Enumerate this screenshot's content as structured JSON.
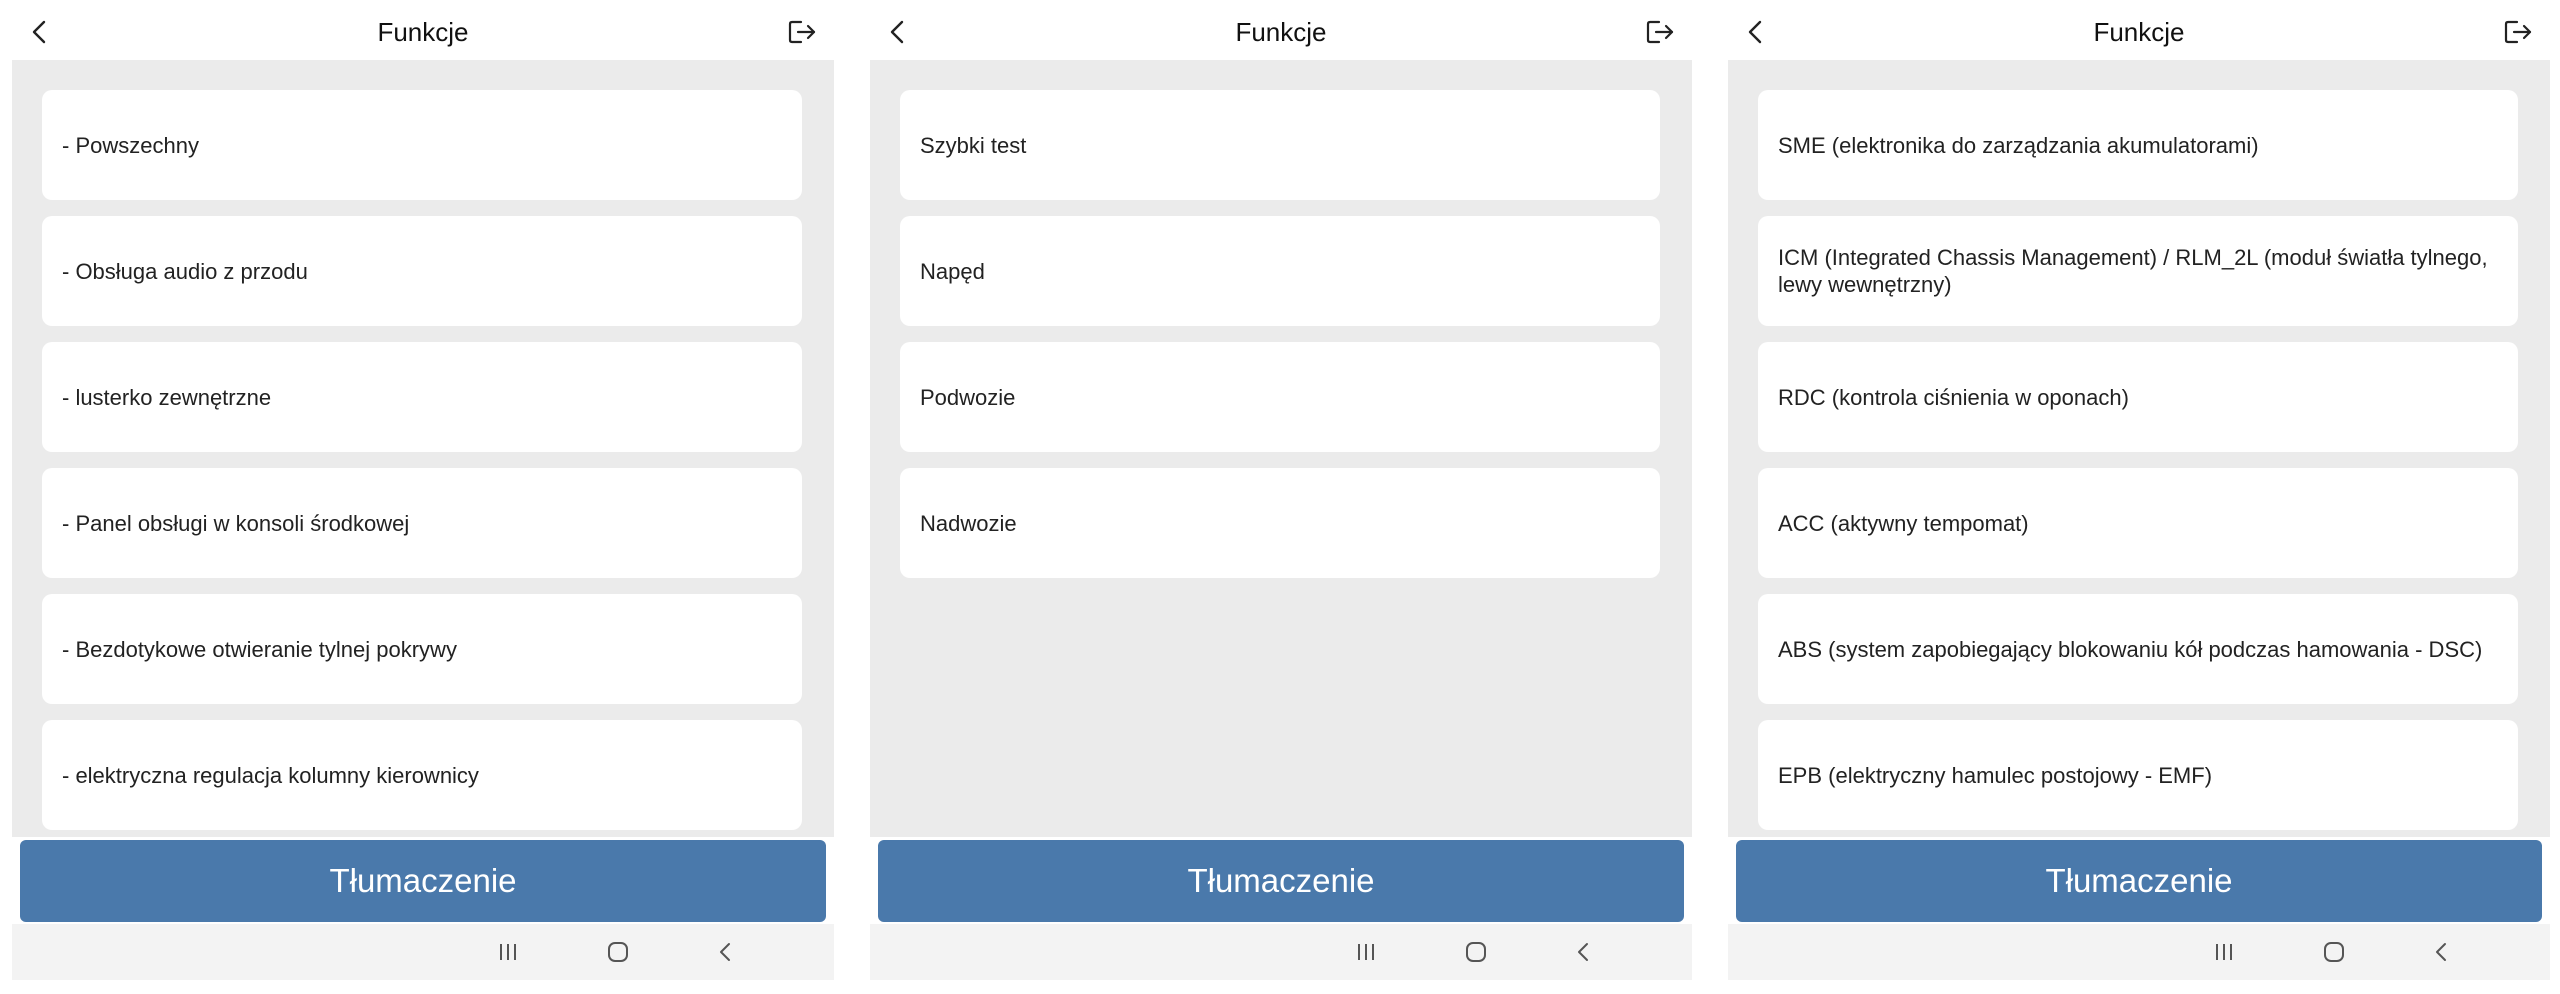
{
  "screens": [
    {
      "title": "Funkcje",
      "items": [
        "- Powszechny",
        "- Obsługa audio z przodu",
        "- lusterko zewnętrzne",
        "- Panel obsługi w konsoli środkowej",
        "- Bezdotykowe otwieranie tylnej pokrywy",
        "- elektryczna regulacja kolumny kierownicy"
      ],
      "translate_label": "Tłumaczenie"
    },
    {
      "title": "Funkcje",
      "items": [
        "Szybki test",
        "Napęd",
        "Podwozie",
        "Nadwozie"
      ],
      "translate_label": "Tłumaczenie"
    },
    {
      "title": "Funkcje",
      "items": [
        "SME (elektronika do zarządzania akumulatorami)",
        "ICM (Integrated Chassis Management) / RLM_2L (moduł światła tylnego, lewy wewnętrzny)",
        "RDC (kontrola ciśnienia w oponach)",
        "ACC (aktywny tempomat)",
        "ABS (system zapobiegający blokowaniu kół podczas hamowania - DSC)",
        "EPB (elektryczny hamulec postojowy - EMF)"
      ],
      "translate_label": "Tłumaczenie"
    }
  ],
  "icons": {
    "back": "chevron-left-icon",
    "logout": "logout-icon",
    "nav_recent": "recent-apps-icon",
    "nav_home": "home-icon",
    "nav_back": "nav-back-icon"
  },
  "colors": {
    "accent": "#4a79ab",
    "content_bg": "#ebebeb",
    "card_bg": "#ffffff",
    "navbar_bg": "#f3f3f3"
  }
}
